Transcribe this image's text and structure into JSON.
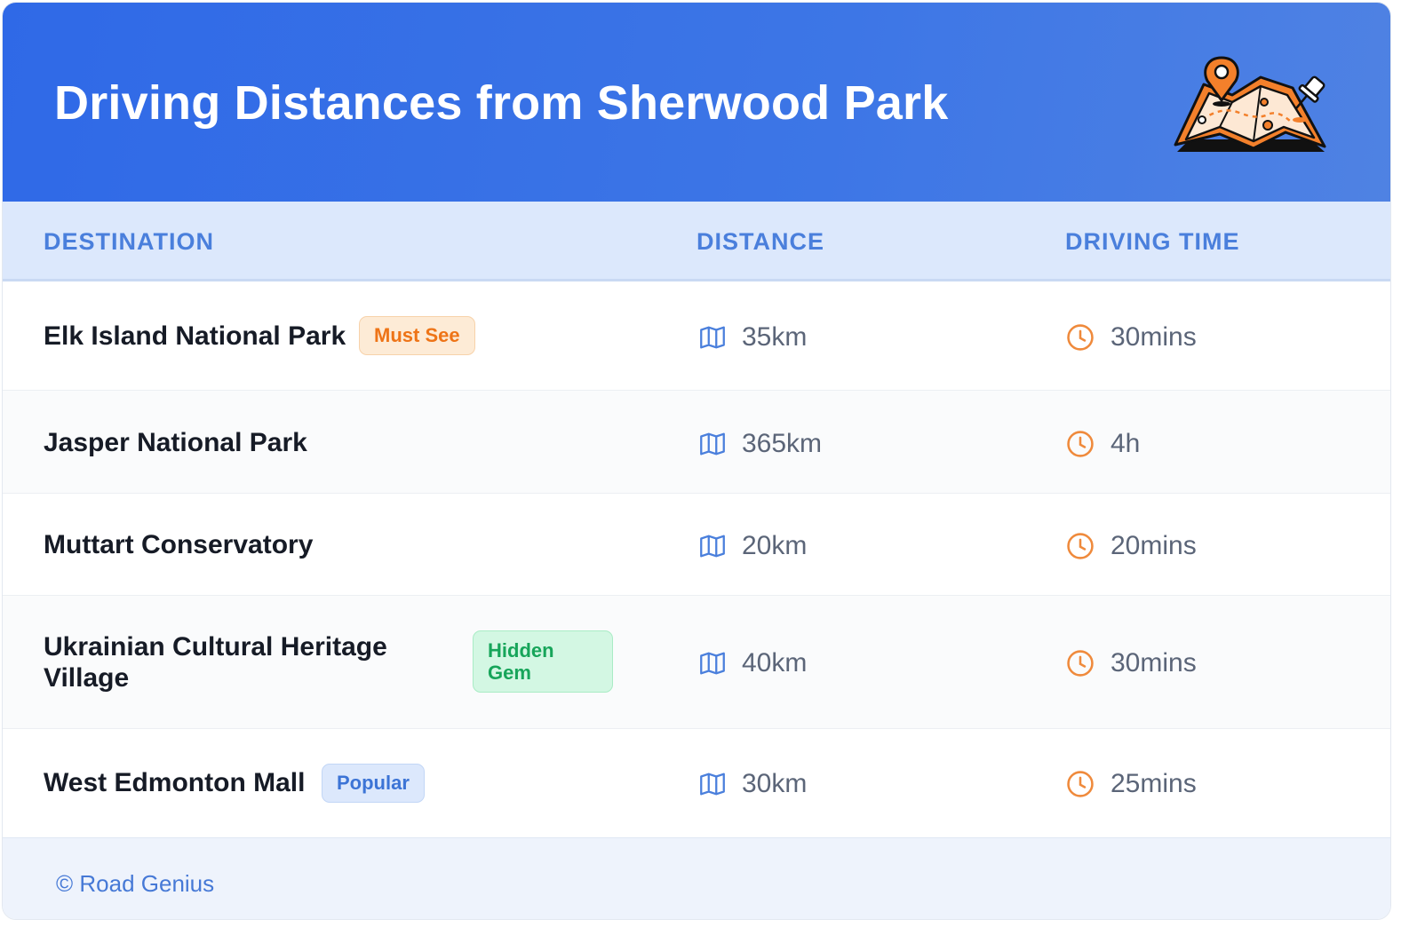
{
  "header": {
    "title": "Driving Distances from Sherwood Park"
  },
  "table": {
    "columns": [
      "DESTINATION",
      "DISTANCE",
      "DRIVING TIME"
    ],
    "rows": [
      {
        "destination": "Elk Island National Park",
        "badge": "Must See",
        "distance": "35km",
        "time": "30mins"
      },
      {
        "destination": "Jasper National Park",
        "badge": "",
        "distance": "365km",
        "time": "4h"
      },
      {
        "destination": "Muttart Conservatory",
        "badge": "",
        "distance": "20km",
        "time": "20mins"
      },
      {
        "destination": "Ukrainian Cultural Heritage Village",
        "badge": "Hidden Gem",
        "distance": "40km",
        "time": "30mins"
      },
      {
        "destination": "West Edmonton Mall",
        "badge": "Popular",
        "distance": "30km",
        "time": "25mins"
      }
    ]
  },
  "icons": {
    "distance": "map-icon",
    "time": "clock-icon",
    "header": "map-with-pins-illustration"
  },
  "colors": {
    "header": "#2f69e7",
    "accent_blue": "#4a7fdc",
    "accent_orange": "#ee7417",
    "accent_green": "#17a55a"
  },
  "footer": {
    "text": "© Road Genius"
  }
}
